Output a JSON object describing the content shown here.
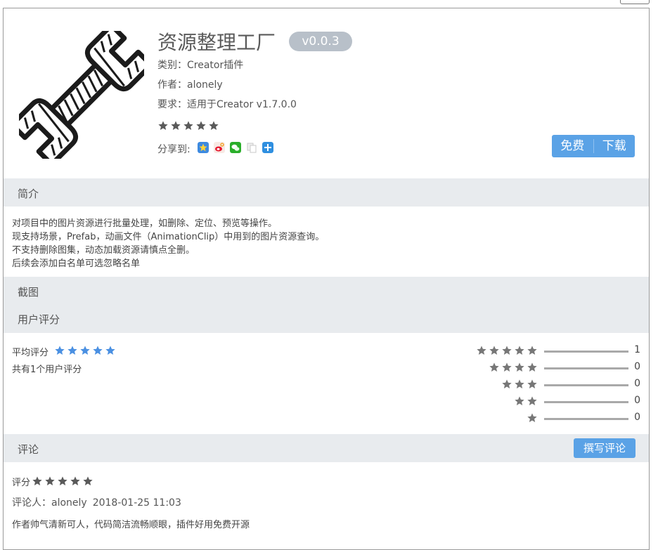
{
  "plugin": {
    "title": "资源整理工厂",
    "version": "v0.0.3",
    "category": "类别：Creator插件",
    "author": "作者：alonely",
    "requirement": "要求：适用于Creator v1.7.0.0",
    "rating_stars": 5,
    "share_label": "分享到:",
    "share_icons": [
      "qzone-icon",
      "weibo-icon",
      "wechat-icon",
      "copy-icon",
      "more-share-icon"
    ]
  },
  "actions": {
    "free_label": "免费",
    "download_label": "下载"
  },
  "sections": {
    "intro": "简介",
    "screenshots": "截图",
    "ratings": "用户评分",
    "comments": "评论"
  },
  "intro_lines": [
    "对项目中的图片资源进行批量处理，如删除、定位、预览等操作。",
    "现支持场景，Prefab，动画文件（AnimationClip）中用到的图片资源查询。",
    "不支持删除图集，动态加载资源请慎点全删。",
    "后续会添加白名单可选忽略名单"
  ],
  "rating": {
    "avg_label": "平均评分",
    "avg_stars": 5,
    "count_text": "共有1个用户评分",
    "distribution": [
      {
        "stars": 5,
        "count": "1"
      },
      {
        "stars": 4,
        "count": "0"
      },
      {
        "stars": 3,
        "count": "0"
      },
      {
        "stars": 2,
        "count": "0"
      },
      {
        "stars": 1,
        "count": "0"
      }
    ]
  },
  "comments": {
    "write_label": "撰写评论",
    "items": [
      {
        "score_label": "评分",
        "stars": 5,
        "reviewer": "评论人：alonely",
        "date": "2018-01-25 11:03",
        "text": "作者帅气清新可人，代码简洁流畅顺眼，插件好用免费开源"
      }
    ]
  },
  "colors": {
    "accent": "#5aa2e6",
    "star_blue": "#4a90e2",
    "star_gray": "#777777",
    "section_bg": "#e8ebee",
    "version_bg": "#b8c0c9"
  }
}
